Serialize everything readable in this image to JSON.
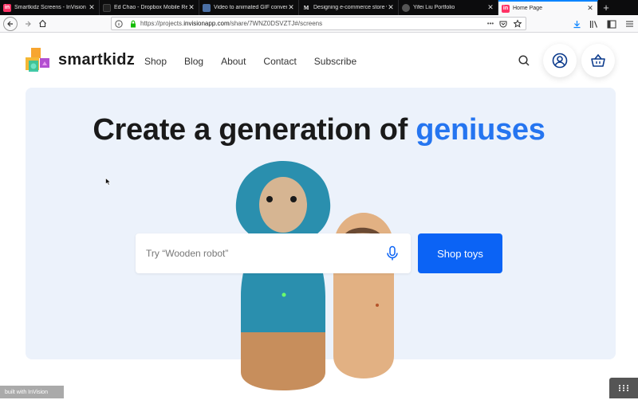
{
  "tabs": [
    {
      "title": "Smartkidz Screens - InVision",
      "fav": "in",
      "fav_color": "#ff3366"
    },
    {
      "title": "Ed Chao - Dropbox Mobile Redesign",
      "fav": "",
      "fav_color": "#333333"
    },
    {
      "title": "Video to animated GIF converter",
      "fav": "",
      "fav_color": "#4a6fa5"
    },
    {
      "title": "Designing e-commerce store w",
      "fav": "M",
      "fav_color": "#ffffff"
    },
    {
      "title": "Yifei Liu Portfolio",
      "fav": "",
      "fav_color": "#555555"
    },
    {
      "title": "Home Page",
      "fav": "in",
      "fav_color": "#ff3366",
      "active": true
    }
  ],
  "url": {
    "prefix": "https://projects.",
    "domain": "invisionapp.com",
    "path": "/share/7WNZ0DSVZTJ#/screens"
  },
  "site": {
    "brand": "smartkidz",
    "nav": [
      "Shop",
      "Blog",
      "About",
      "Contact",
      "Subscribe"
    ],
    "headline_main": "Create a generation of ",
    "headline_accent": "geniuses",
    "search_placeholder": "Try “Wooden robot”",
    "shop_button": "Shop toys"
  },
  "badge": "built with InVision",
  "colors": {
    "accent": "#2575f0",
    "button": "#0b63f5",
    "hero_bg": "#ecf2fb"
  }
}
